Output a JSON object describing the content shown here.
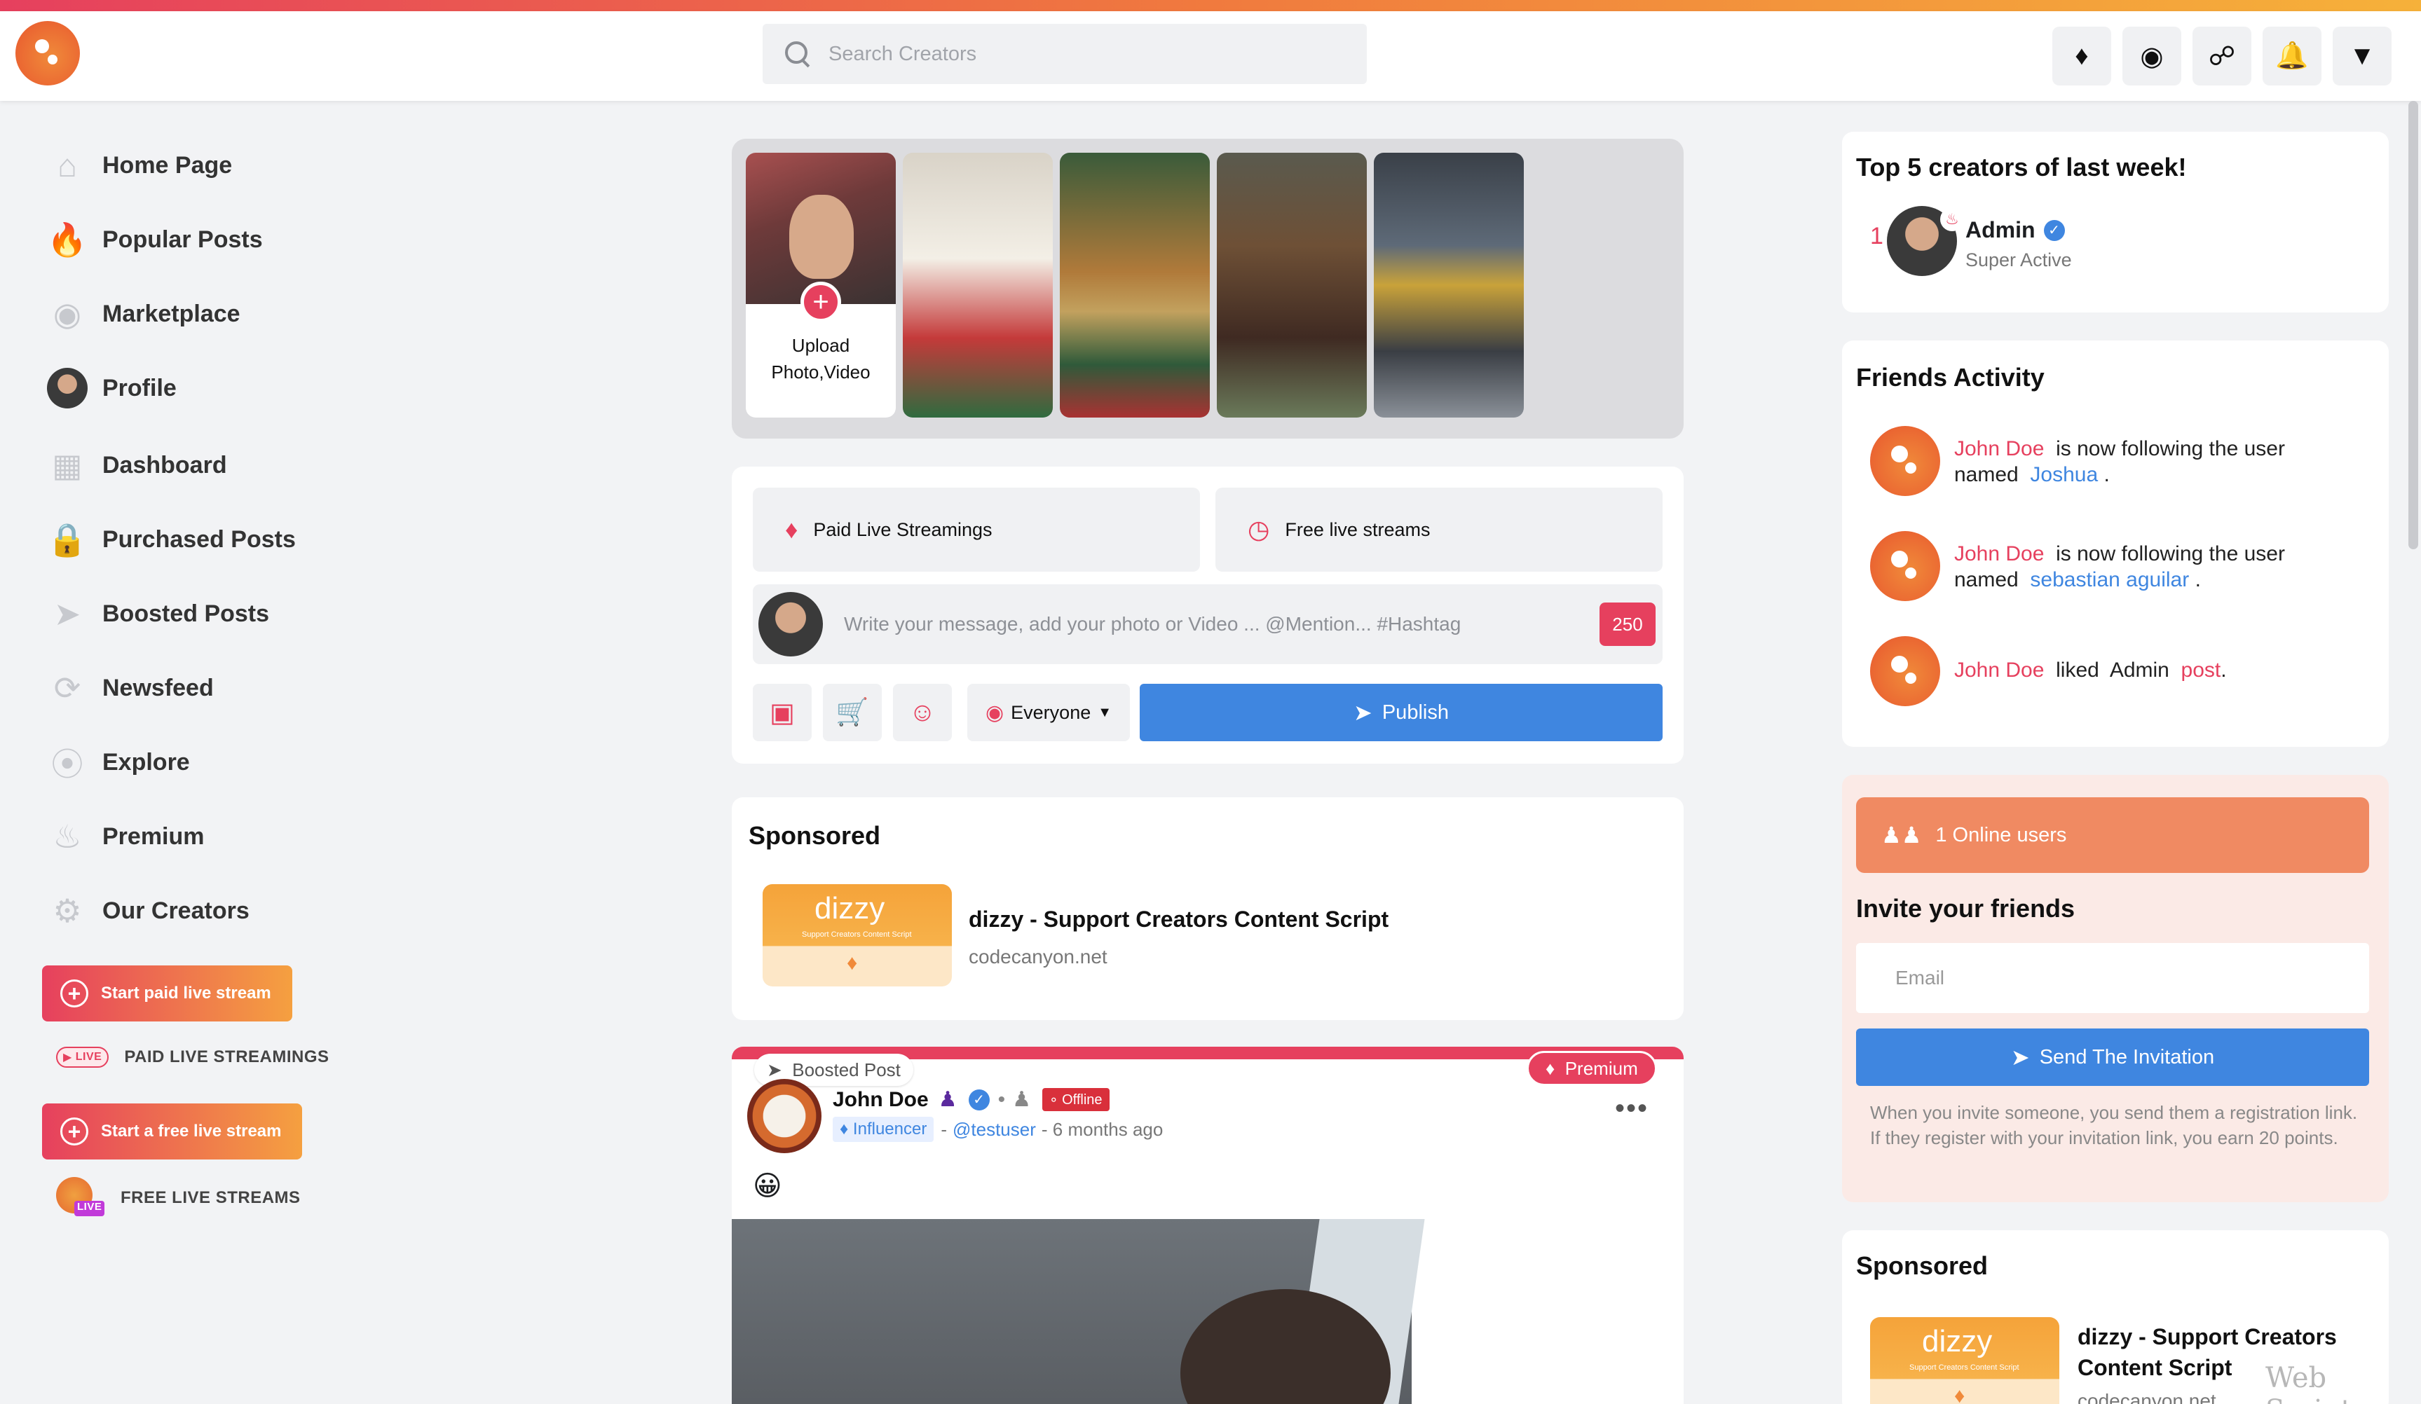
{
  "header": {
    "search_placeholder": "Search Creators",
    "icons": [
      "gem-icon",
      "store-icon",
      "messenger-icon",
      "bell-icon",
      "caret-down-icon"
    ]
  },
  "sidebar": {
    "items": [
      {
        "label": "Home Page",
        "icon": "home-icon"
      },
      {
        "label": "Popular Posts",
        "icon": "fire-icon"
      },
      {
        "label": "Marketplace",
        "icon": "store-icon"
      },
      {
        "label": "Profile",
        "icon": "avatar"
      },
      {
        "label": "Dashboard",
        "icon": "dashboard-icon"
      },
      {
        "label": "Purchased Posts",
        "icon": "lock-icon"
      },
      {
        "label": "Boosted Posts",
        "icon": "rocket-icon"
      },
      {
        "label": "Newsfeed",
        "icon": "newsfeed-icon"
      },
      {
        "label": "Explore",
        "icon": "compass-icon"
      },
      {
        "label": "Premium",
        "icon": "premium-icon"
      },
      {
        "label": "Our Creators",
        "icon": "creators-icon"
      }
    ],
    "start_paid_live": "Start paid live stream",
    "live_badge": "LIVE",
    "paid_live_streamings": "PAID LIVE STREAMINGS",
    "start_free_live": "Start a free live stream",
    "free_live_streams": "FREE LIVE STREAMS"
  },
  "stories": {
    "upload_caption_line1": "Upload",
    "upload_caption_line2": "Photo,Video"
  },
  "composer": {
    "paid_live_tab": "Paid Live Streamings",
    "free_live_tab": "Free live streams",
    "placeholder": "Write your message, add your photo or Video ... @Mention... #Hashtag",
    "char_count": "250",
    "audience": "Everyone",
    "publish": "Publish"
  },
  "sponsored_center": {
    "title": "Sponsored",
    "thumb_logo": "dizzy",
    "thumb_sub": "Support Creators Content Script",
    "name": "dizzy - Support Creators Content Script",
    "url": "codecanyon.net"
  },
  "post": {
    "boost_label": "Boosted Post",
    "premium_label": "Premium",
    "author": "John Doe",
    "status": "Offline",
    "badge": "Influencer",
    "handle": "@testuser",
    "time": "- 6 months ago",
    "separator": "-",
    "more": "•••",
    "emoji": "😀"
  },
  "top_creators": {
    "title": "Top 5 creators of last week!",
    "rank": "1",
    "name": "Admin",
    "status": "Super Active"
  },
  "friends_activity": {
    "title": "Friends Activity",
    "items": [
      {
        "user": "John Doe",
        "text": "is now following the user named",
        "target": "Joshua",
        "end": "."
      },
      {
        "user": "John Doe",
        "text": "is now following the user named",
        "target": "sebastian aguilar",
        "end": "."
      },
      {
        "user": "John Doe",
        "text": "liked",
        "target": "Admin",
        "extra": "post",
        "end": "."
      }
    ]
  },
  "invite": {
    "online_users": "1 Online users",
    "title": "Invite your friends",
    "email_placeholder": "Email",
    "send": "Send The Invitation",
    "note": "When you invite someone, you send them a registration link. If they register with your invitation link, you earn 20 points."
  },
  "sponsored_right": {
    "title": "Sponsored",
    "thumb_logo": "dizzy",
    "thumb_sub": "Support Creators Content Script",
    "name": "dizzy - Support Creators Content Script",
    "url": "codecanyon.net"
  },
  "watermark": "Web Script",
  "colors": {
    "accent": "#e6405e",
    "primary": "#3f86e0",
    "orange": "#f08a3a"
  }
}
